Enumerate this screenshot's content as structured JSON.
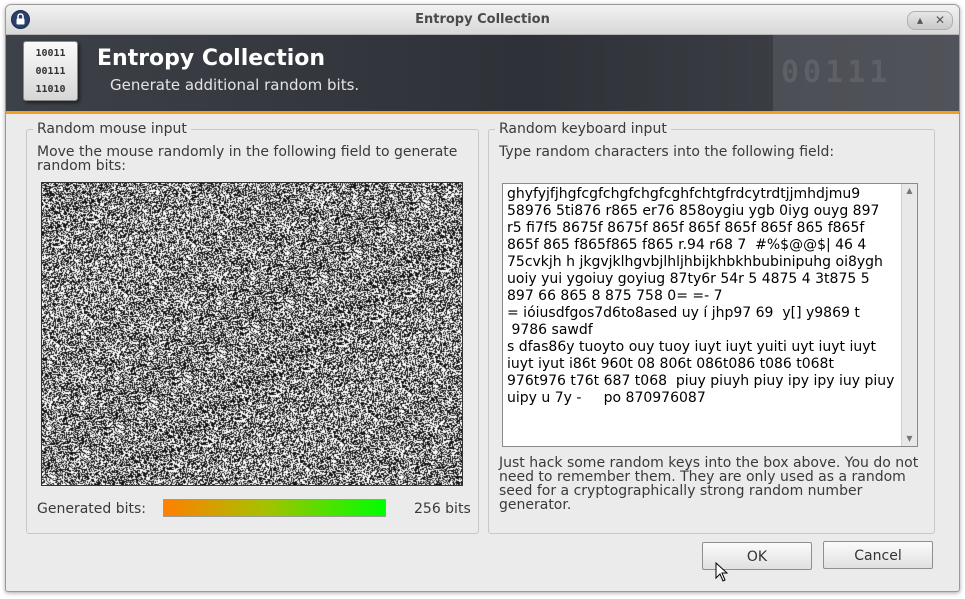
{
  "window": {
    "title": "Entropy Collection"
  },
  "banner": {
    "title": "Entropy Collection",
    "subtitle": "Generate additional random bits.",
    "icon_lines": [
      "10011",
      "00111",
      "11010"
    ],
    "deco_text": "00111",
    "accent_color": "#f0a020"
  },
  "mouse_group": {
    "label": "Random mouse input",
    "instructions_line1": "Move the mouse randomly in the following field to generate",
    "instructions_line2": "random bits:",
    "generated_label": "Generated bits:",
    "generated_value": "256 bits",
    "progress": 1.0
  },
  "keyboard_group": {
    "label": "Random keyboard input",
    "instructions": "Type random characters into the following field:",
    "text_lines": [
      "ghyfyjfjhgfcgfchgfchgfcghfchtgfrdcytrdtjjmhdjmu9",
      "58976 5ti876 r865 er76 858oygiu ygb 0iyg ouyg 897",
      "r5 fi7f5 8675f 8675f 865f 865f 865f 865f 865 f865f",
      "865f 865 f865f865 f865 r.94 r68 7  #%$@@$| 46 4",
      "75cvkjh h jkgvjklhgvbjlhljhbijkhbkhbubinipuhg oi8ygh",
      "uoiy yui ygoiuy goyiug 87ty6r 54r 5 4875 4 3t875 5",
      "897 66 865 8 875 758 0= =- 7",
      "= ióiusdfgos7d6to8ased uy í jhp97 69  y[] y9869 t",
      " 9786 sawdf",
      "s dfas86y tuoyto ouy tuoy iuyt iuyt yuiti uyt iuyt iuyt",
      "iuyt iyut i86t 960t 08 806t 086t086 t086 t068t",
      "976t976 t76t 687 t068  piuy piuyh piuy ipy ipy iuy piuy",
      "uipy u 7y -     po 870976087"
    ],
    "hint_line1": "Just hack some random keys into the box above. You do not",
    "hint_line2": "need to remember them. They are only used as a random",
    "hint_line3": "seed for a cryptographically strong random number",
    "hint_line4": "generator."
  },
  "buttons": {
    "ok": "OK",
    "cancel": "Cancel"
  }
}
